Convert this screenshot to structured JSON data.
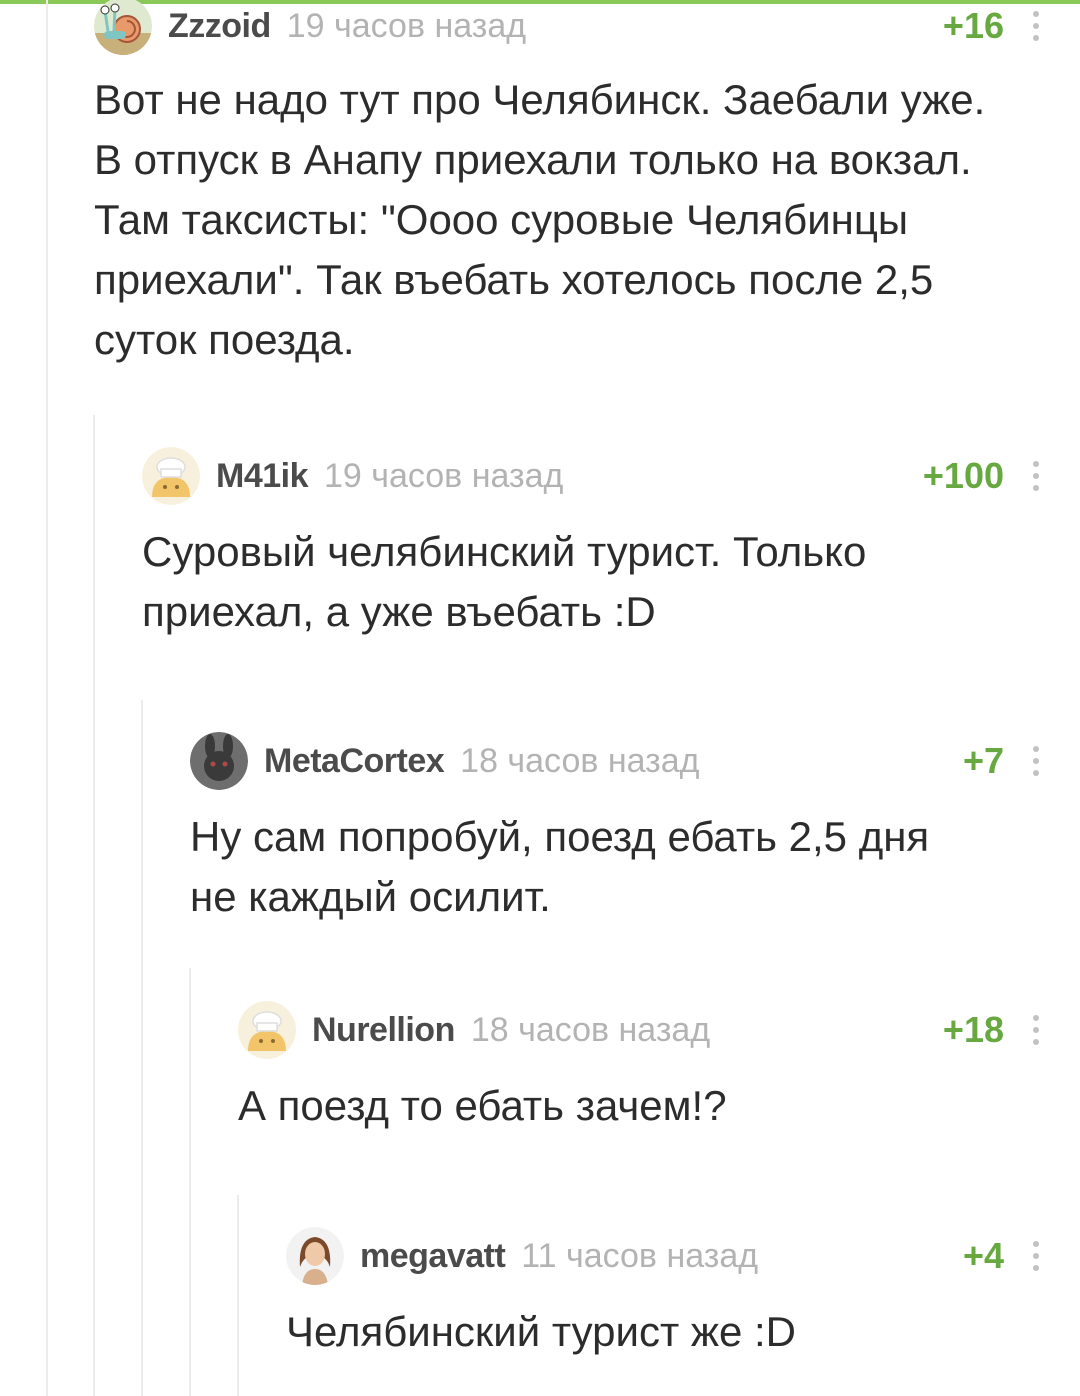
{
  "accent_color": "#8ac858",
  "rating_color": "#67a840",
  "comments": [
    {
      "username": "Zzzoid",
      "time": "19 часов назад",
      "rating": "+16",
      "avatar_icon": "snail-avatar",
      "text_lines": [
        "Вот не надо тут про Челябинск. Заебали уже.",
        "В отпуск в Анапу приехали только на вокзал.",
        "Там таксисты: \"Оооо суровые Челябинцы",
        "приехали\". Так въебать хотелось после 2,5",
        "суток поезда."
      ]
    },
    {
      "username": "M41ik",
      "time": "19 часов назад",
      "rating": "+100",
      "avatar_icon": "default-cook-avatar",
      "text_lines": [
        "Суровый челябинский турист. Только",
        "приехал, а уже въебать :D"
      ]
    },
    {
      "username": "MetaCortex",
      "time": "18 часов назад",
      "rating": "+7",
      "avatar_icon": "dark-bunny-avatar",
      "text_lines": [
        "Ну сам попробуй, поезд ебать 2,5 дня",
        "не каждый осилит."
      ]
    },
    {
      "username": "Nurellion",
      "time": "18 часов назад",
      "rating": "+18",
      "avatar_icon": "default-cook-avatar",
      "text_lines": [
        "А поезд то ебать зачем!?"
      ]
    },
    {
      "username": "megavatt",
      "time": "11 часов назад",
      "rating": "+4",
      "avatar_icon": "woman-avatar",
      "text_lines": [
        "Челябинский турист же :D"
      ]
    }
  ]
}
